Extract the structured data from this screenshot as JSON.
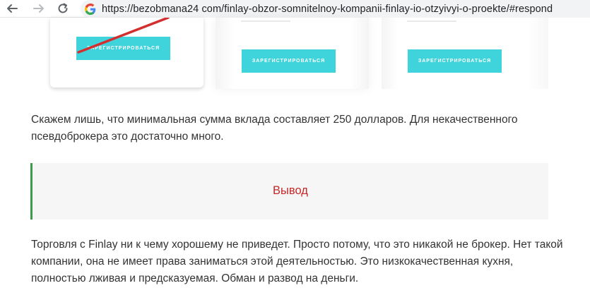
{
  "browser": {
    "url": "https://bezobmana24 com/finlay-obzor-somnitelnoy-kompanii-finlay-io-otzyivyi-o-proekte/#respond",
    "back_icon": "back-arrow-icon",
    "forward_icon": "forward-arrow-icon",
    "reload_icon": "reload-icon",
    "site_icon": "google-icon"
  },
  "cards": [
    {
      "button_label": "ЗАРЕГИСТРИРОВАТЬСЯ"
    },
    {
      "button_label": "ЗАРЕГИСТРИРОВАТЬСЯ"
    },
    {
      "button_label": "ЗАРЕГИСТРИРОВАТЬСЯ"
    }
  ],
  "article": {
    "paragraph_1": "Скажем лишь, что минимальная сумма вклада составляет 250 долларов. Для некачественного псевдоброкера это достаточно много.",
    "conclusion_title": "Вывод",
    "paragraph_2": "Торговля с Finlay ни к чему хорошему не приведет. Просто потому, что это никакой не брокер. Нет такой компании, она не имеет права заниматься этой деятельностью. Это низкокачественная кухня, полностью лживая и предсказуемая. Обман и развод на деньги."
  },
  "colors": {
    "button": "#3fd3db",
    "conclusion_accent": "#3d9b4f",
    "conclusion_title": "#c62828",
    "annotation_stroke": "#d32f2f"
  }
}
